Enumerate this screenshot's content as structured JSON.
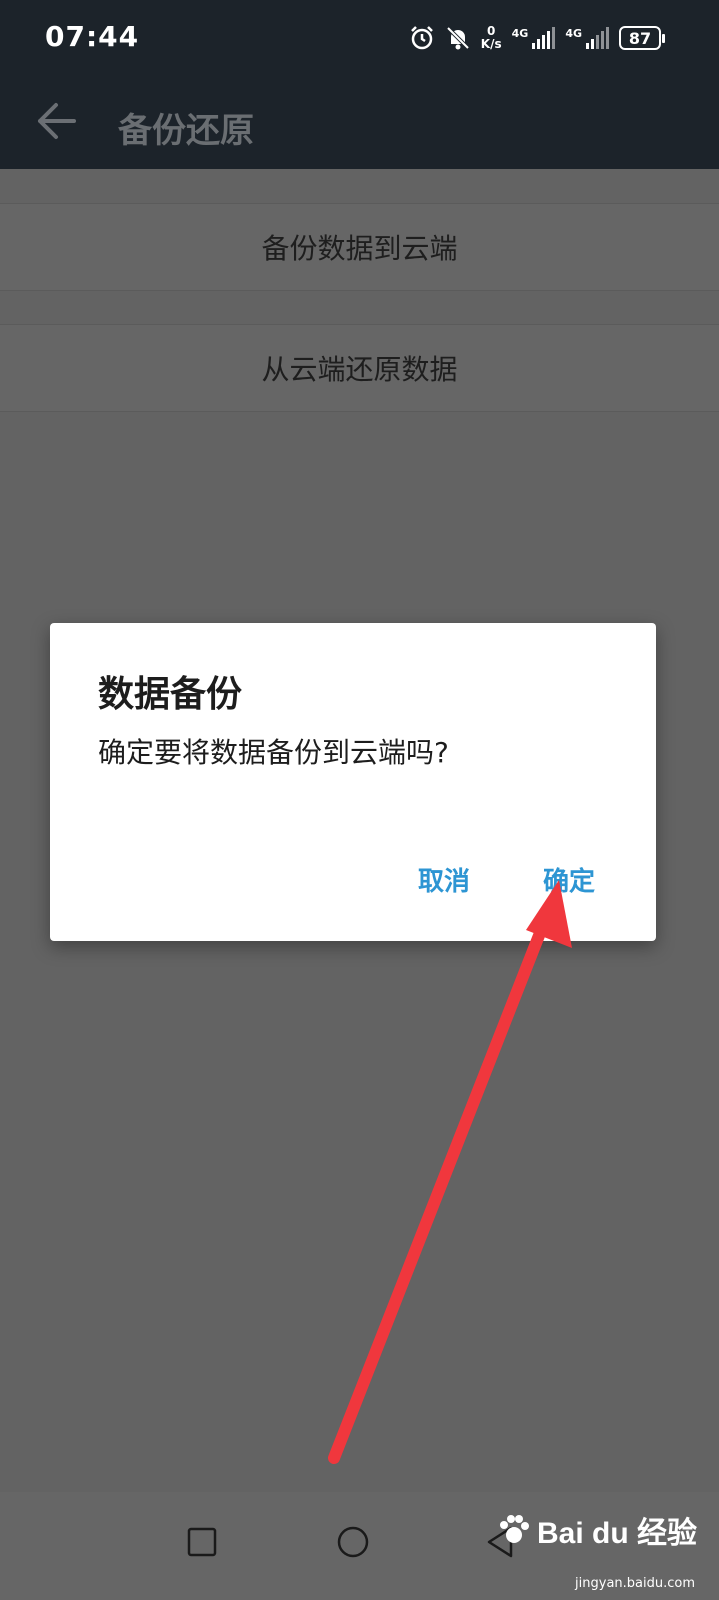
{
  "status_bar": {
    "time": "07:44",
    "net_speed_value": "0",
    "net_speed_unit": "K/s",
    "sim1_label": "4G",
    "sim2_label": "4G",
    "battery": "87",
    "icons": [
      "alarm-icon",
      "mute-icon",
      "signal-icon",
      "signal-icon",
      "battery-icon"
    ]
  },
  "header": {
    "title": "备份还原"
  },
  "list": {
    "items": [
      {
        "label": "备份数据到云端"
      },
      {
        "label": "从云端还原数据"
      }
    ]
  },
  "dialog": {
    "title": "数据备份",
    "message": "确定要将数据备份到云端吗?",
    "cancel_label": "取消",
    "confirm_label": "确定"
  },
  "watermark": {
    "brand": "Bai du 经验",
    "url": "jingyan.baidu.com"
  },
  "colors": {
    "dialog_button": "#2d95d3",
    "annotation_arrow": "#f0373d",
    "overlay_background": "#636363",
    "header_background": "#1c232a"
  }
}
